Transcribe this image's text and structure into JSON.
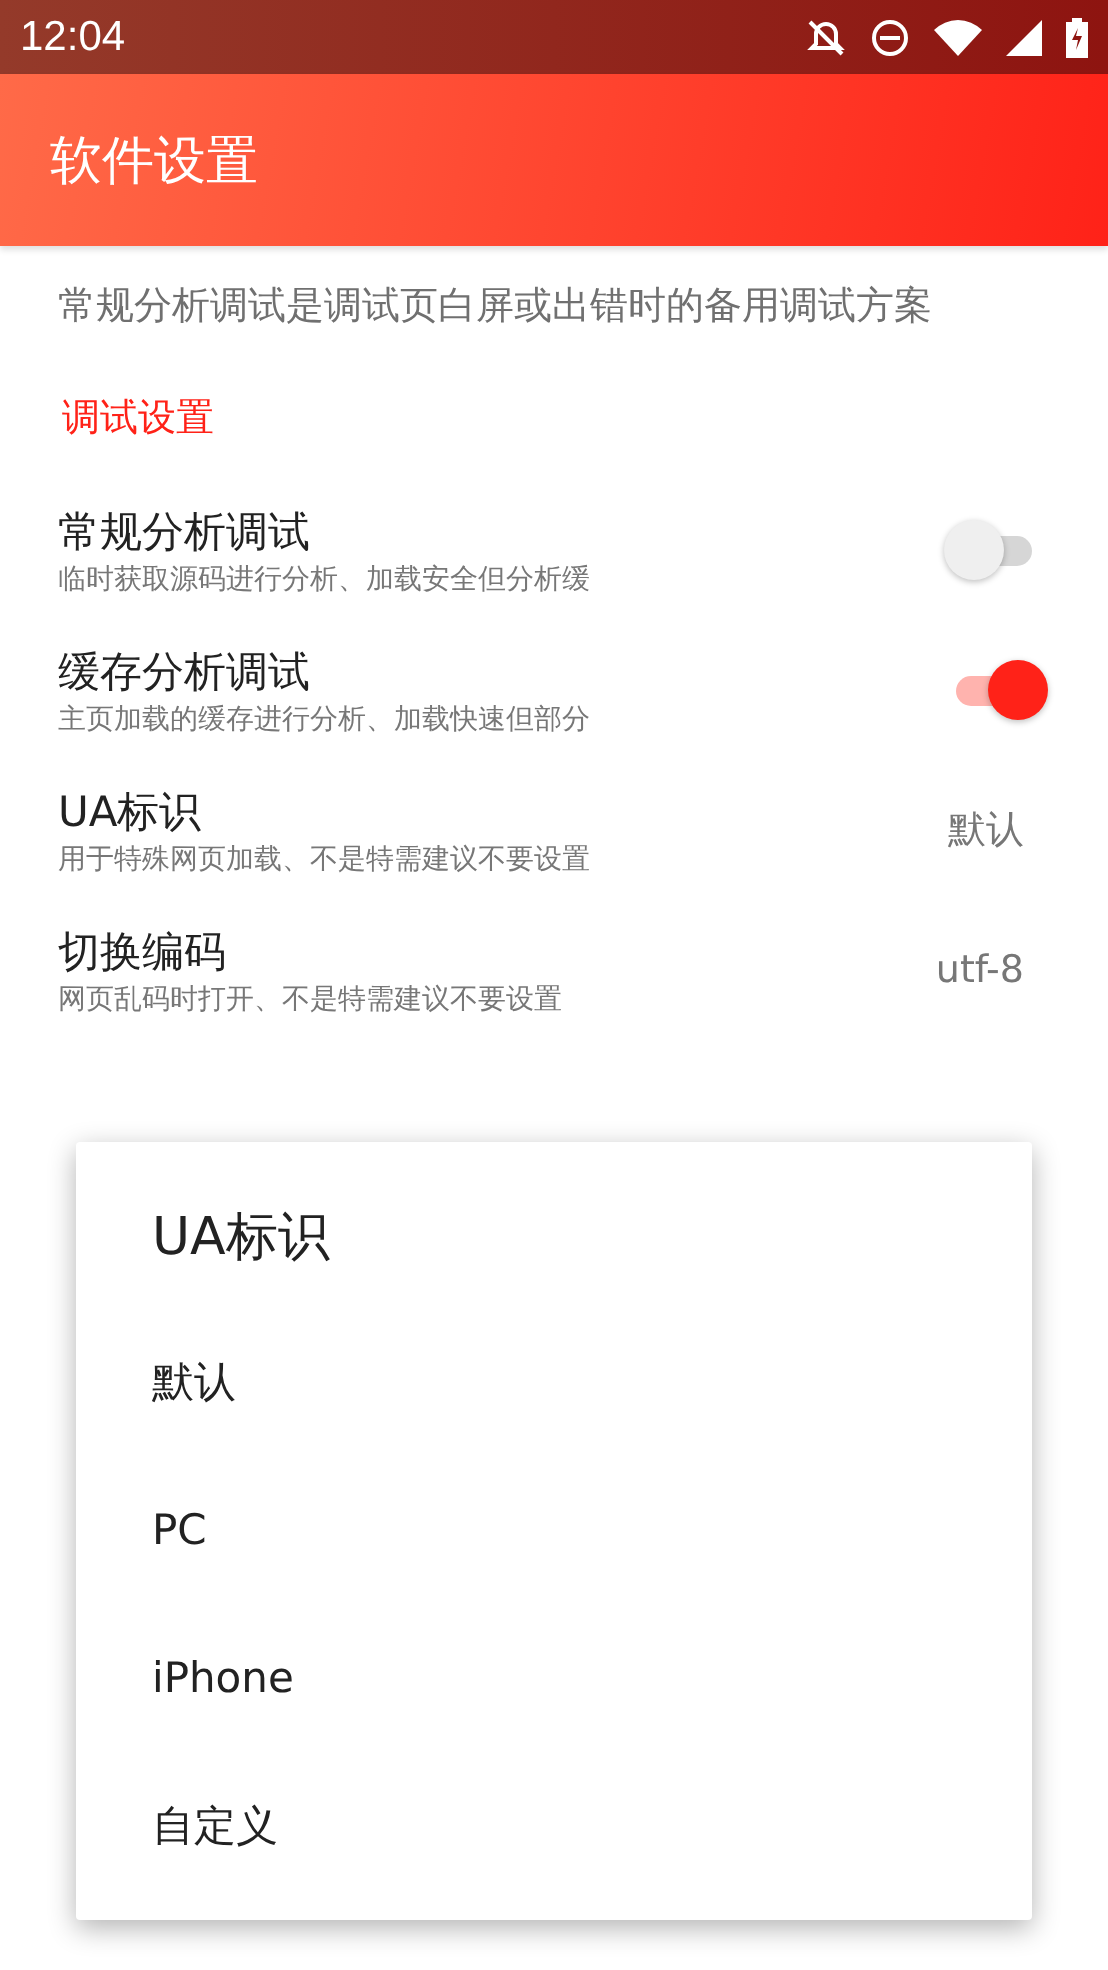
{
  "status_bar": {
    "time": "12:04"
  },
  "app_bar": {
    "title": "软件设置"
  },
  "summary": "常规分析调试是调试页白屏或出错时的备用调试方案",
  "category": "调试设置",
  "settings": [
    {
      "kind": "switch",
      "title": "常规分析调试",
      "subtitle": "临时获取源码进行分析、加载安全但分析缓",
      "checked": false
    },
    {
      "kind": "switch",
      "title": "缓存分析调试",
      "subtitle": "主页加载的缓存进行分析、加载快速但部分",
      "checked": true
    },
    {
      "kind": "value",
      "title": "UA标识",
      "subtitle": "用于特殊网页加载、不是特需建议不要设置",
      "value": "默认"
    },
    {
      "kind": "value",
      "title": "切换编码",
      "subtitle": "网页乱码时打开、不是特需建议不要设置",
      "value": "utf-8"
    }
  ],
  "dialog": {
    "title": "UA标识",
    "options": [
      "默认",
      "PC",
      "iPhone",
      "自定义"
    ]
  }
}
